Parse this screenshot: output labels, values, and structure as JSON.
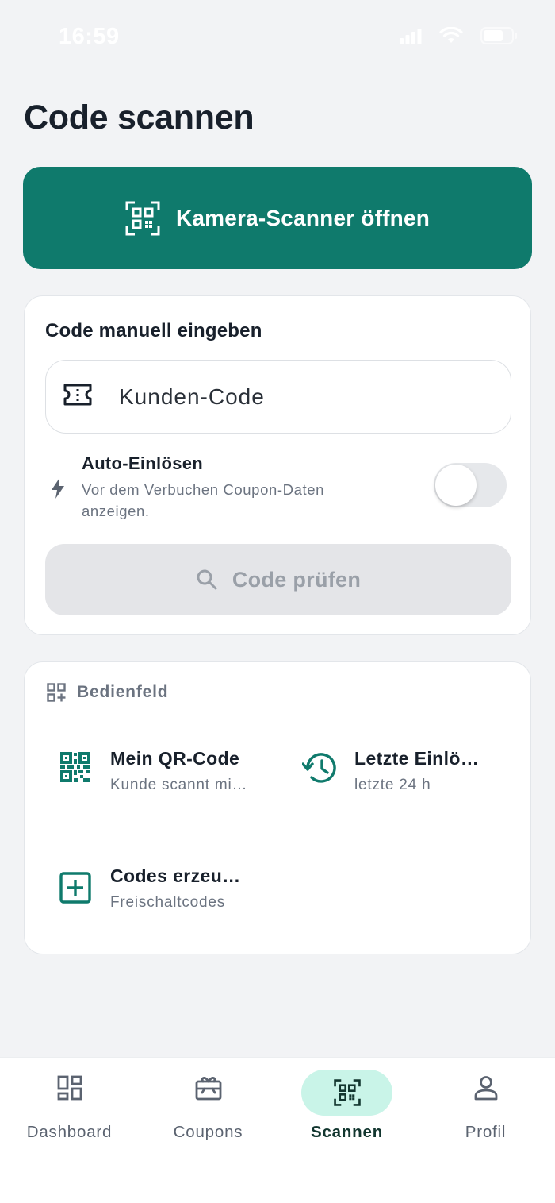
{
  "status_bar": {
    "time": "16:59"
  },
  "page": {
    "title": "Code scannen"
  },
  "camera_button": {
    "label": "Kamera-Scanner öffnen",
    "icon": "qr-scan-icon",
    "color": "#0f7a6c"
  },
  "manual_entry": {
    "title": "Code manuell eingeben",
    "input": {
      "placeholder": "Kunden-Code",
      "value": "",
      "icon": "ticket-icon"
    },
    "auto_redeem": {
      "title": "Auto-Einlösen",
      "description": "Vor dem Verbuchen Coupon-Daten anzeigen.",
      "icon": "bolt-icon",
      "enabled": false
    },
    "check_button": {
      "label": "Code prüfen",
      "icon": "search-icon",
      "disabled": true
    }
  },
  "panel": {
    "title": "Bedienfeld",
    "icon": "grid-plus-icon",
    "tiles": [
      {
        "title": "Mein QR-Code",
        "subtitle": "Kunde scannt mi…",
        "icon": "qr-code-icon"
      },
      {
        "title": "Letzte Einlö…",
        "subtitle": "letzte 24 h",
        "icon": "history-icon"
      },
      {
        "title": "Codes erzeu…",
        "subtitle": "Freischaltcodes",
        "icon": "add-box-icon"
      }
    ]
  },
  "bottom_nav": {
    "items": [
      {
        "label": "Dashboard",
        "icon": "dashboard-icon",
        "active": false
      },
      {
        "label": "Coupons",
        "icon": "gift-card-icon",
        "active": false
      },
      {
        "label": "Scannen",
        "icon": "qr-scan-icon",
        "active": true
      },
      {
        "label": "Profil",
        "icon": "person-icon",
        "active": false
      }
    ]
  },
  "colors": {
    "accent": "#0f7a6c",
    "active_pill": "#c9f4e8",
    "background": "#f2f3f5"
  }
}
